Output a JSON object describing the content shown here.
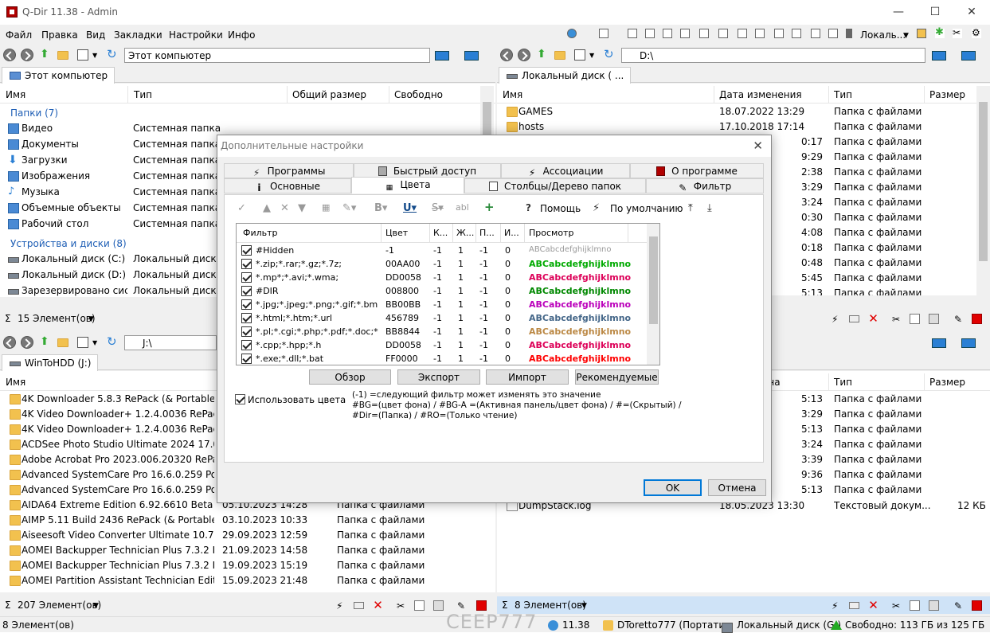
{
  "window": {
    "title": "Q-Dir 11.38 - Admin",
    "controls": {
      "minimize": "—",
      "maximize": "☐",
      "close": "✕"
    }
  },
  "menubar": {
    "items": [
      "Файл",
      "Правка",
      "Вид",
      "Закладки",
      "Настройки",
      "Инфо"
    ],
    "drive_label": "Локаль..."
  },
  "pane_tl": {
    "address": "Этот компьютер",
    "tab": "Этот компьютер",
    "columns": [
      "Имя",
      "Тип",
      "Общий размер",
      "Свободно"
    ],
    "groups": [
      {
        "label": "Папки (7)",
        "items": [
          {
            "name": "Видео",
            "type": "Системная папка",
            "icon": "video-folder-icon"
          },
          {
            "name": "Документы",
            "type": "Системная папка",
            "icon": "documents-folder-icon"
          },
          {
            "name": "Загрузки",
            "type": "Системная папка",
            "icon": "downloads-folder-icon"
          },
          {
            "name": "Изображения",
            "type": "Системная папка",
            "icon": "pictures-folder-icon"
          },
          {
            "name": "Музыка",
            "type": "Системная папка",
            "icon": "music-folder-icon"
          },
          {
            "name": "Объемные объекты",
            "type": "Системная папка",
            "icon": "3d-objects-icon"
          },
          {
            "name": "Рабочий стол",
            "type": "Системная папка",
            "icon": "desktop-folder-icon"
          }
        ]
      },
      {
        "label": "Устройства и диски (8)",
        "items": [
          {
            "name": "Локальный диск (C:)",
            "type": "Локальный диск",
            "icon": "drive-icon"
          },
          {
            "name": "Локальный диск (D:)",
            "type": "Локальный диск",
            "icon": "drive-icon"
          },
          {
            "name": "Зарезервировано сис...",
            "type": "Локальный диск",
            "icon": "drive-icon"
          }
        ]
      }
    ],
    "status": "15 Элемент(ов)"
  },
  "pane_tr": {
    "address": "D:\\",
    "tab": "Локальный диск ( ...",
    "columns": [
      "Имя",
      "Дата изменения",
      "Тип",
      "Размер"
    ],
    "rows": [
      {
        "name": "GAMES",
        "date": "18.07.2022 13:29",
        "type": "Папка с файлами"
      },
      {
        "name": "hosts",
        "date": "17.10.2018 17:14",
        "type": "Папка с файлами"
      },
      {
        "name": "",
        "date": "0:17",
        "type": "Папка с файлами"
      },
      {
        "name": "",
        "date": "9:29",
        "type": "Папка с файлами"
      },
      {
        "name": "",
        "date": "2:38",
        "type": "Папка с файлами"
      },
      {
        "name": "",
        "date": "3:29",
        "type": "Папка с файлами"
      },
      {
        "name": "",
        "date": "3:24",
        "type": "Папка с файлами"
      },
      {
        "name": "",
        "date": "0:30",
        "type": "Папка с файлами"
      },
      {
        "name": "",
        "date": "4:08",
        "type": "Папка с файлами"
      },
      {
        "name": "",
        "date": "0:18",
        "type": "Папка с файлами"
      },
      {
        "name": "",
        "date": "0:48",
        "type": "Папка с файлами"
      },
      {
        "name": "",
        "date": "5:45",
        "type": "Папка с файлами"
      },
      {
        "name": "",
        "date": "5:13",
        "type": "Папка с файлами"
      }
    ]
  },
  "pane_bl": {
    "address": "J:\\",
    "tab": "WinToHDD (J:)",
    "columns": [
      "Имя"
    ],
    "rows": [
      {
        "name": "4K Downloader 5.8.3 RePack (& Portable) by...",
        "date": "",
        "type": ""
      },
      {
        "name": "4K Video Downloader+ 1.2.4.0036 RePack (&...",
        "date": "",
        "type": ""
      },
      {
        "name": "4K Video Downloader+ 1.2.4.0036 RePack (&...",
        "date": "",
        "type": ""
      },
      {
        "name": "ACDSee Photo Studio Ultimate 2024 17.0.1.3...",
        "date": "",
        "type": ""
      },
      {
        "name": "Adobe Acrobat Pro 2023.006.20320 RePack b...",
        "date": "",
        "type": ""
      },
      {
        "name": "Advanced SystemCare Pro 16.6.0.259 Portab...",
        "date": "",
        "type": ""
      },
      {
        "name": "Advanced SystemCare Pro 16.6.0.259 Portab...",
        "date": "",
        "type": ""
      },
      {
        "name": "AIDA64 Extreme Edition 6.92.6610 Beta Portan...",
        "date": "05.10.2023 14:28",
        "type": "Папка с файлами"
      },
      {
        "name": "AIMP 5.11 Build 2436 RePack (& Portable) b...",
        "date": "03.10.2023 10:33",
        "type": "Папка с файлами"
      },
      {
        "name": "Aiseesoft Video Converter Ultimate 10.7.28 R...",
        "date": "29.09.2023 12:59",
        "type": "Папка с файлами"
      },
      {
        "name": "AOMEI Backupper Technician Plus 7.3.2 Rep...",
        "date": "21.09.2023 14:58",
        "type": "Папка с файлами"
      },
      {
        "name": "AOMEI Backupper Technician Plus 7.3.2 ReP...",
        "date": "19.09.2023 15:19",
        "type": "Папка с файлами"
      },
      {
        "name": "AOMEI Partition Assistant Technician Editio...",
        "date": "15.09.2023 21:48",
        "type": "Папка с файлами"
      }
    ],
    "status": "207 Элемент(ов)"
  },
  "pane_br": {
    "columns": [
      "Тип",
      "Размер"
    ],
    "col_fragment": "ена",
    "rows": [
      {
        "date": "5:13",
        "type": "Папка с файлами"
      },
      {
        "date": "3:29",
        "type": "Папка с файлами"
      },
      {
        "date": "5:13",
        "type": "Папка с файлами"
      },
      {
        "date": "3:24",
        "type": "Папка с файлами"
      },
      {
        "date": "3:39",
        "type": "Папка с файлами"
      },
      {
        "date": "9:36",
        "type": "Папка с файлами"
      },
      {
        "date": "5:13",
        "type": "Папка с файлами"
      }
    ],
    "file": {
      "name": "DumpStack.log",
      "date": "18.05.2023 13:30",
      "type": "Текстовый докум...",
      "size": "12 КБ"
    },
    "status": "8 Элемент(ов)"
  },
  "bottombar": {
    "items_count": "8 Элемент(ов)",
    "watermark": "CEEP777",
    "version": "11.38",
    "user": "DToretto777 (Портатив",
    "drive": "Локальный диск (G:)",
    "free": "Свободно: 113 ГБ из 125 ГБ"
  },
  "dialog": {
    "title": "Дополнительные настройки",
    "tabs_top": [
      "Программы",
      "Быстрый доступ",
      "Ассоциации",
      "О программе"
    ],
    "tabs_bottom": [
      "Основные",
      "Цвета",
      "Столбцы/Дерево папок",
      "Фильтр"
    ],
    "toolbar": {
      "help": "Помощь",
      "default": "По умолчанию"
    },
    "grid_columns": [
      "Фильтр",
      "Цвет",
      "К...",
      "Ж...",
      "П...",
      "И...",
      "Просмотр"
    ],
    "grid_rows": [
      {
        "filter": "#Hidden",
        "color": "-1",
        "k": "-1",
        "zh": "1",
        "p": "-1",
        "i": "0",
        "preview": "ABCabcdefghijklmno",
        "pcolor": "#9a9a9a",
        "bold": false
      },
      {
        "filter": "*.zip;*.rar;*.gz;*.7z;",
        "color": "00AA00",
        "k": "-1",
        "zh": "1",
        "p": "-1",
        "i": "0",
        "preview": "ABCabcdefghijklmno",
        "pcolor": "#00AA00",
        "bold": true
      },
      {
        "filter": "*.mp*;*.avi;*.wma;",
        "color": "DD0058",
        "k": "-1",
        "zh": "1",
        "p": "-1",
        "i": "0",
        "preview": "ABCabcdefghijklmno",
        "pcolor": "#DD0058",
        "bold": true
      },
      {
        "filter": "#DIR",
        "color": "008800",
        "k": "-1",
        "zh": "1",
        "p": "-1",
        "i": "0",
        "preview": "ABCabcdefghijklmno",
        "pcolor": "#008800",
        "bold": true
      },
      {
        "filter": "*.jpg;*.jpeg;*.png;*.gif;*.bmp;*.ico",
        "color": "BB00BB",
        "k": "-1",
        "zh": "1",
        "p": "-1",
        "i": "0",
        "preview": "ABCabcdefghijklmno",
        "pcolor": "#BB00BB",
        "bold": true
      },
      {
        "filter": "*.html;*.htm;*.url",
        "color": "456789",
        "k": "-1",
        "zh": "1",
        "p": "-1",
        "i": "0",
        "preview": "ABCabcdefghijklmno",
        "pcolor": "#456789",
        "bold": true
      },
      {
        "filter": "*.pl;*.cgi;*.php;*.pdf;*.doc;*.rtf;*...",
        "color": "BB8844",
        "k": "-1",
        "zh": "1",
        "p": "-1",
        "i": "0",
        "preview": "ABCabcdefghijklmno",
        "pcolor": "#BB8844",
        "bold": true
      },
      {
        "filter": "*.cpp;*.hpp;*.h",
        "color": "DD0058",
        "k": "-1",
        "zh": "1",
        "p": "-1",
        "i": "0",
        "preview": "ABCabcdefghijklmno",
        "pcolor": "#DD0058",
        "bold": true
      },
      {
        "filter": "*.exe;*.dll;*.bat",
        "color": "FF0000",
        "k": "-1",
        "zh": "1",
        "p": "-1",
        "i": "0",
        "preview": "ABCabcdefghijklmno",
        "pcolor": "#FF0000",
        "bold": true
      }
    ],
    "buttons": {
      "browse": "Обзор",
      "export": "Экспорт",
      "import": "Импорт",
      "recommended": "Рекомендуемые",
      "ok": "OK",
      "cancel": "Отмена"
    },
    "use_colors": "Использовать цвета",
    "hint_lines": [
      "(-1) =следующий фильтр может изменять это значение",
      "#BG=(цвет фона) / #BG-A =(Активная панель/цвет фона) / #=(Скрытый) /",
      "#Dir=(Папка) / #RO=(Только чтение)"
    ]
  },
  "colors": {
    "accent": "#0078d7",
    "group_blue": "#1e5eb5",
    "folder": "#f2c14e",
    "red": "#e00000"
  }
}
